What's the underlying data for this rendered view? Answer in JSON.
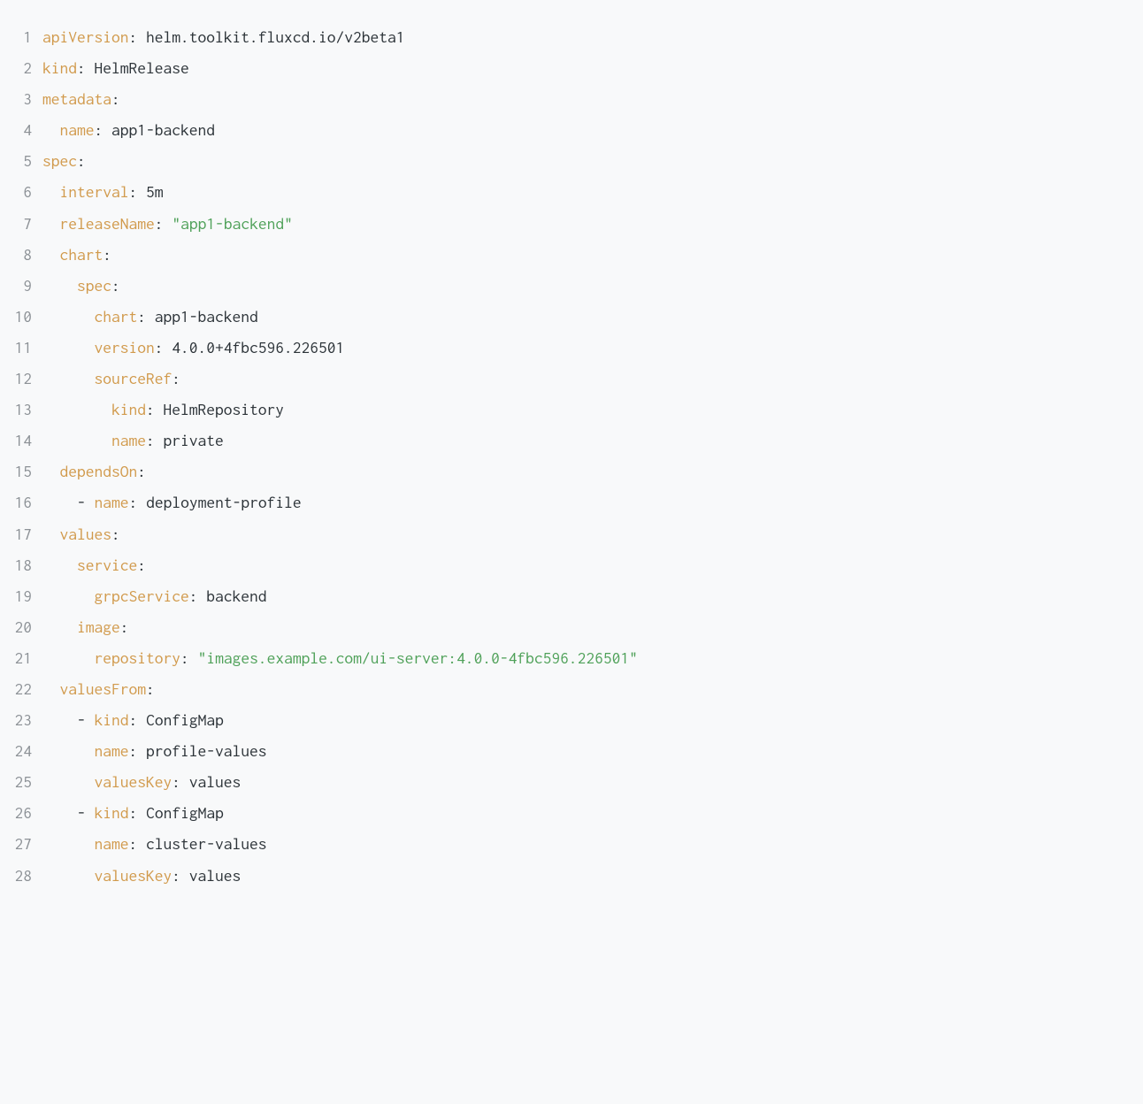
{
  "code": {
    "lines": [
      [
        {
          "cls": "tok-key",
          "text": "apiVersion"
        },
        {
          "cls": "tok-punct",
          "text": ":"
        },
        {
          "cls": "tok-val",
          "text": " helm.toolkit.fluxcd.io/v2beta1"
        }
      ],
      [
        {
          "cls": "tok-key",
          "text": "kind"
        },
        {
          "cls": "tok-punct",
          "text": ":"
        },
        {
          "cls": "tok-val",
          "text": " HelmRelease"
        }
      ],
      [
        {
          "cls": "tok-key",
          "text": "metadata"
        },
        {
          "cls": "tok-punct",
          "text": ":"
        }
      ],
      [
        {
          "cls": "tok-val",
          "text": "  "
        },
        {
          "cls": "tok-key",
          "text": "name"
        },
        {
          "cls": "tok-punct",
          "text": ":"
        },
        {
          "cls": "tok-val",
          "text": " app1-backend"
        }
      ],
      [
        {
          "cls": "tok-key",
          "text": "spec"
        },
        {
          "cls": "tok-punct",
          "text": ":"
        }
      ],
      [
        {
          "cls": "tok-val",
          "text": "  "
        },
        {
          "cls": "tok-key",
          "text": "interval"
        },
        {
          "cls": "tok-punct",
          "text": ":"
        },
        {
          "cls": "tok-val",
          "text": " 5m"
        }
      ],
      [
        {
          "cls": "tok-val",
          "text": "  "
        },
        {
          "cls": "tok-key",
          "text": "releaseName"
        },
        {
          "cls": "tok-punct",
          "text": ":"
        },
        {
          "cls": "tok-val",
          "text": " "
        },
        {
          "cls": "tok-str",
          "text": "\"app1-backend\""
        }
      ],
      [
        {
          "cls": "tok-val",
          "text": "  "
        },
        {
          "cls": "tok-key",
          "text": "chart"
        },
        {
          "cls": "tok-punct",
          "text": ":"
        }
      ],
      [
        {
          "cls": "tok-val",
          "text": "    "
        },
        {
          "cls": "tok-key",
          "text": "spec"
        },
        {
          "cls": "tok-punct",
          "text": ":"
        }
      ],
      [
        {
          "cls": "tok-val",
          "text": "      "
        },
        {
          "cls": "tok-key",
          "text": "chart"
        },
        {
          "cls": "tok-punct",
          "text": ":"
        },
        {
          "cls": "tok-val",
          "text": " app1-backend"
        }
      ],
      [
        {
          "cls": "tok-val",
          "text": "      "
        },
        {
          "cls": "tok-key",
          "text": "version"
        },
        {
          "cls": "tok-punct",
          "text": ":"
        },
        {
          "cls": "tok-val",
          "text": " 4.0.0+4fbc596.226501"
        }
      ],
      [
        {
          "cls": "tok-val",
          "text": "      "
        },
        {
          "cls": "tok-key",
          "text": "sourceRef"
        },
        {
          "cls": "tok-punct",
          "text": ":"
        }
      ],
      [
        {
          "cls": "tok-val",
          "text": "        "
        },
        {
          "cls": "tok-key",
          "text": "kind"
        },
        {
          "cls": "tok-punct",
          "text": ":"
        },
        {
          "cls": "tok-val",
          "text": " HelmRepository"
        }
      ],
      [
        {
          "cls": "tok-val",
          "text": "        "
        },
        {
          "cls": "tok-key",
          "text": "name"
        },
        {
          "cls": "tok-punct",
          "text": ":"
        },
        {
          "cls": "tok-val",
          "text": " private"
        }
      ],
      [
        {
          "cls": "tok-val",
          "text": "  "
        },
        {
          "cls": "tok-key",
          "text": "dependsOn"
        },
        {
          "cls": "tok-punct",
          "text": ":"
        }
      ],
      [
        {
          "cls": "tok-val",
          "text": "    "
        },
        {
          "cls": "tok-punct",
          "text": "-"
        },
        {
          "cls": "tok-val",
          "text": " "
        },
        {
          "cls": "tok-key",
          "text": "name"
        },
        {
          "cls": "tok-punct",
          "text": ":"
        },
        {
          "cls": "tok-val",
          "text": " deployment-profile"
        }
      ],
      [
        {
          "cls": "tok-val",
          "text": "  "
        },
        {
          "cls": "tok-key",
          "text": "values"
        },
        {
          "cls": "tok-punct",
          "text": ":"
        }
      ],
      [
        {
          "cls": "tok-val",
          "text": "    "
        },
        {
          "cls": "tok-key",
          "text": "service"
        },
        {
          "cls": "tok-punct",
          "text": ":"
        }
      ],
      [
        {
          "cls": "tok-val",
          "text": "      "
        },
        {
          "cls": "tok-key",
          "text": "grpcService"
        },
        {
          "cls": "tok-punct",
          "text": ":"
        },
        {
          "cls": "tok-val",
          "text": " backend"
        }
      ],
      [
        {
          "cls": "tok-val",
          "text": "    "
        },
        {
          "cls": "tok-key",
          "text": "image"
        },
        {
          "cls": "tok-punct",
          "text": ":"
        }
      ],
      [
        {
          "cls": "tok-val",
          "text": "      "
        },
        {
          "cls": "tok-key",
          "text": "repository"
        },
        {
          "cls": "tok-punct",
          "text": ":"
        },
        {
          "cls": "tok-val",
          "text": " "
        },
        {
          "cls": "tok-str",
          "text": "\"images.example.com/ui-server:4.0.0-4fbc596.226501\""
        }
      ],
      [
        {
          "cls": "tok-val",
          "text": "  "
        },
        {
          "cls": "tok-key",
          "text": "valuesFrom"
        },
        {
          "cls": "tok-punct",
          "text": ":"
        }
      ],
      [
        {
          "cls": "tok-val",
          "text": "    "
        },
        {
          "cls": "tok-punct",
          "text": "-"
        },
        {
          "cls": "tok-val",
          "text": " "
        },
        {
          "cls": "tok-key",
          "text": "kind"
        },
        {
          "cls": "tok-punct",
          "text": ":"
        },
        {
          "cls": "tok-val",
          "text": " ConfigMap"
        }
      ],
      [
        {
          "cls": "tok-val",
          "text": "      "
        },
        {
          "cls": "tok-key",
          "text": "name"
        },
        {
          "cls": "tok-punct",
          "text": ":"
        },
        {
          "cls": "tok-val",
          "text": " profile-values"
        }
      ],
      [
        {
          "cls": "tok-val",
          "text": "      "
        },
        {
          "cls": "tok-key",
          "text": "valuesKey"
        },
        {
          "cls": "tok-punct",
          "text": ":"
        },
        {
          "cls": "tok-val",
          "text": " values"
        }
      ],
      [
        {
          "cls": "tok-val",
          "text": "    "
        },
        {
          "cls": "tok-punct",
          "text": "-"
        },
        {
          "cls": "tok-val",
          "text": " "
        },
        {
          "cls": "tok-key",
          "text": "kind"
        },
        {
          "cls": "tok-punct",
          "text": ":"
        },
        {
          "cls": "tok-val",
          "text": " ConfigMap"
        }
      ],
      [
        {
          "cls": "tok-val",
          "text": "      "
        },
        {
          "cls": "tok-key",
          "text": "name"
        },
        {
          "cls": "tok-punct",
          "text": ":"
        },
        {
          "cls": "tok-val",
          "text": " cluster-values"
        }
      ],
      [
        {
          "cls": "tok-val",
          "text": "      "
        },
        {
          "cls": "tok-key",
          "text": "valuesKey"
        },
        {
          "cls": "tok-punct",
          "text": ":"
        },
        {
          "cls": "tok-val",
          "text": " values"
        }
      ]
    ]
  }
}
